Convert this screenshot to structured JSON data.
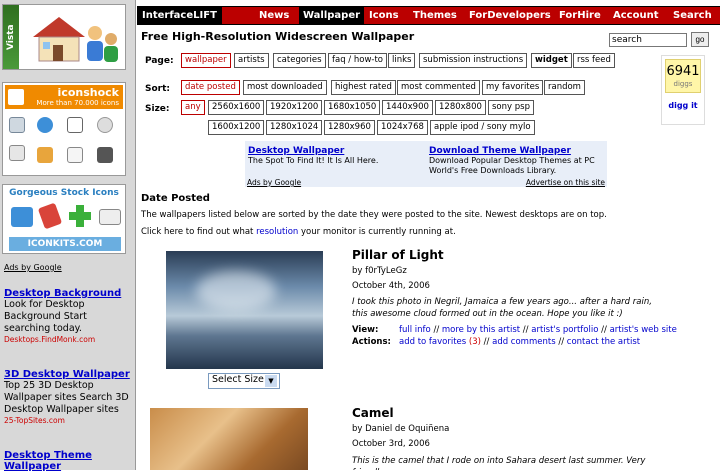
{
  "sidebar": {
    "vista_label": "Vista",
    "iconshock": {
      "name": "iconshock",
      "tagline": "More than 70.000 icons"
    },
    "iconkits": {
      "title": "Gorgeous Stock Icons",
      "logo": "ICONKITS.COM"
    },
    "ads_by": "Ads by Google",
    "ads": [
      {
        "title": "Desktop Background",
        "desc": "Look for Desktop Background Start searching today.",
        "url": "Desktops.FindMonk.com"
      },
      {
        "title": "3D Desktop Wallpaper",
        "desc": "Top 25 3D Desktop Wallpaper sites Search 3D Desktop Wallpaper sites",
        "url": "25-TopSites.com"
      },
      {
        "title": "Desktop Theme Wallpaper",
        "desc": "",
        "url": ""
      }
    ]
  },
  "nav": {
    "brand": "InterfaceLIFT",
    "items": [
      "News",
      "Wallpaper",
      "Icons",
      "Themes",
      "ForDevelopers",
      "ForHire",
      "Account",
      "Search"
    ]
  },
  "title": "Free High-Resolution Widescreen Wallpaper",
  "search": {
    "value": "search",
    "go": "go"
  },
  "page_label": "Page:",
  "pages": [
    "wallpaper",
    "artists",
    "categories",
    "faq / how-to",
    "links",
    "submission instructions",
    "widget",
    "rss feed"
  ],
  "sort_label": "Sort:",
  "sorts": [
    "date posted",
    "most downloaded",
    "highest rated",
    "most commented",
    "my favorites",
    "random"
  ],
  "size_label": "Size:",
  "sizes_row1": [
    "any",
    "2560x1600",
    "1920x1200",
    "1680x1050",
    "1440x900",
    "1280x800",
    "sony psp"
  ],
  "sizes_row2": [
    "1600x1200",
    "1280x1024",
    "1280x960",
    "1024x768",
    "apple ipod / sony mylo"
  ],
  "digg": {
    "count": "6941",
    "unit": "diggs",
    "action": "digg it"
  },
  "google_ads": {
    "left": {
      "title": "Desktop Wallpaper",
      "desc": "The Spot To Find It! It Is All Here."
    },
    "right": {
      "title": "Download Theme Wallpaper",
      "desc": "Download Popular Desktop Themes at PC World's Free Downloads Library."
    },
    "by": "Ads by Google",
    "advertise": "Advertise on this site"
  },
  "date_posted": "Date Posted",
  "sorted_text": "The wallpapers listed below are sorted by the date they were posted to the site. Newest desktops are on top.",
  "click_pre": "Click here to find out what ",
  "click_link": "resolution",
  "click_post": " your monitor is currently running at.",
  "wallpapers": [
    {
      "title": "Pillar of Light",
      "by": "by f0rTyLeGz",
      "date": "October 4th, 2006",
      "desc": "I took this photo in Negril, Jamaica a few years ago... after a hard rain, this awesome cloud formed out in the ocean. Hope you like it :)",
      "view_label": "View:",
      "actions_label": "Actions:",
      "view": [
        "full info",
        "more by this artist",
        "artist's portfolio",
        "artist's web site"
      ],
      "fav": "add to favorites",
      "fav_count": "(3)",
      "comment": "add comments",
      "contact": "contact the artist",
      "select": "Select Size"
    },
    {
      "title": "Camel",
      "by": "by Daniel de Oquiñena",
      "date": "October 3rd, 2006",
      "desc": "This is the camel that I rode on into Sahara desert last summer. Very friendly"
    }
  ],
  "colors": {
    "nav_red": "#bb0000",
    "link": "#0000cc",
    "ad_url": "#cc0000"
  }
}
